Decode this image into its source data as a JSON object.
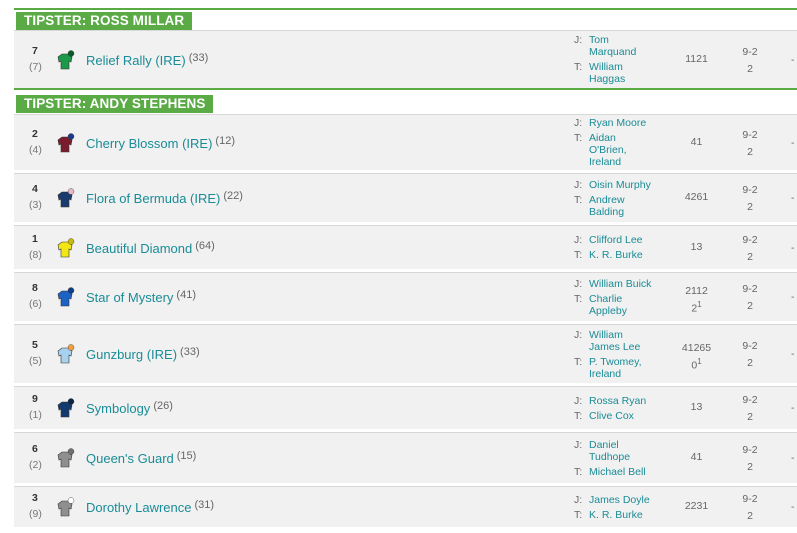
{
  "sections": [
    {
      "title": "TIPSTER: ROSS MILLAR"
    },
    {
      "title": "TIPSTER: ANDY STEPHENS"
    }
  ],
  "runners": [
    {
      "num": "7",
      "draw": "(7)",
      "horse": "Relief Rally (IRE)",
      "age": "(33)",
      "jockey": [
        "Tom",
        "Marquand"
      ],
      "trainer": [
        "William",
        "Haggas"
      ],
      "form": "1121",
      "form_sup": "",
      "odds_top": "9-2",
      "odds_bottom": "2",
      "dash": "-",
      "silk_colors": [
        "#1a9a4a",
        "#0f5a2a"
      ]
    },
    {
      "num": "2",
      "draw": "(4)",
      "horse": "Cherry Blossom (IRE)",
      "age": "(12)",
      "jockey": [
        "Ryan Moore"
      ],
      "trainer": [
        "Aidan",
        "O'Brien,",
        "Ireland"
      ],
      "form": "41",
      "form_sup": "",
      "odds_top": "9-2",
      "odds_bottom": "2",
      "dash": "-",
      "silk_colors": [
        "#7a1c2c",
        "#1b3c8c"
      ]
    },
    {
      "num": "4",
      "draw": "(3)",
      "horse": "Flora of Bermuda (IRE)",
      "age": "(22)",
      "jockey": [
        "Oisin Murphy"
      ],
      "trainer": [
        "Andrew",
        "Balding"
      ],
      "form": "4261",
      "form_sup": "",
      "odds_top": "9-2",
      "odds_bottom": "2",
      "dash": "-",
      "silk_colors": [
        "#1a3b6e",
        "#e7b7c8"
      ]
    },
    {
      "num": "1",
      "draw": "(8)",
      "horse": "Beautiful Diamond",
      "age": "(64)",
      "jockey": [
        "Clifford Lee"
      ],
      "trainer": [
        "K. R. Burke"
      ],
      "form": "13",
      "form_sup": "",
      "odds_top": "9-2",
      "odds_bottom": "2",
      "dash": "-",
      "silk_colors": [
        "#f2e614",
        "#c7bb10"
      ]
    },
    {
      "num": "8",
      "draw": "(6)",
      "horse": "Star of Mystery",
      "age": "(41)",
      "jockey": [
        "William Buick"
      ],
      "trainer": [
        "Charlie",
        "Appleby"
      ],
      "form": "2112",
      "form_sub": "2",
      "form_sup": "1",
      "odds_top": "9-2",
      "odds_bottom": "2",
      "dash": "-",
      "silk_colors": [
        "#1d63c6",
        "#0f3e86"
      ]
    },
    {
      "num": "5",
      "draw": "(5)",
      "horse": "Gunzburg (IRE)",
      "age": "(33)",
      "jockey": [
        "William",
        "James Lee"
      ],
      "trainer": [
        "P. Twomey,",
        "Ireland"
      ],
      "form": "41265",
      "form_sub": "0",
      "form_sup": "1",
      "odds_top": "9-2",
      "odds_bottom": "2",
      "dash": "-",
      "silk_colors": [
        "#a8d0ef",
        "#f0a040"
      ]
    },
    {
      "num": "9",
      "draw": "(1)",
      "horse": "Symbology",
      "age": "(26)",
      "jockey": [
        "Rossa Ryan"
      ],
      "trainer": [
        "Clive Cox"
      ],
      "form": "13",
      "form_sup": "",
      "odds_top": "9-2",
      "odds_bottom": "2",
      "dash": "-",
      "silk_colors": [
        "#123a6e",
        "#0b2448"
      ]
    },
    {
      "num": "6",
      "draw": "(2)",
      "horse": "Queen's Guard",
      "age": "(15)",
      "jockey": [
        "Daniel",
        "Tudhope"
      ],
      "trainer": [
        "Michael Bell"
      ],
      "form": "41",
      "form_sup": "",
      "odds_top": "9-2",
      "odds_bottom": "2",
      "dash": "-",
      "silk_colors": [
        "#8f8f8f",
        "#6f6f6f"
      ]
    },
    {
      "num": "3",
      "draw": "(9)",
      "horse": "Dorothy Lawrence",
      "age": "(31)",
      "jockey": [
        "James Doyle"
      ],
      "trainer": [
        "K. R. Burke"
      ],
      "form": "2231",
      "form_sup": "",
      "odds_top": "9-2",
      "odds_bottom": "2",
      "dash": "-",
      "silk_colors": [
        "#8f8f8f",
        "#ffffff"
      ]
    }
  ],
  "labels": {
    "jockey": "J:",
    "trainer": "T:"
  },
  "colors": {
    "accent": "#5aaa45",
    "link": "#1a8c97",
    "row_bg": "#f0f1f0"
  }
}
